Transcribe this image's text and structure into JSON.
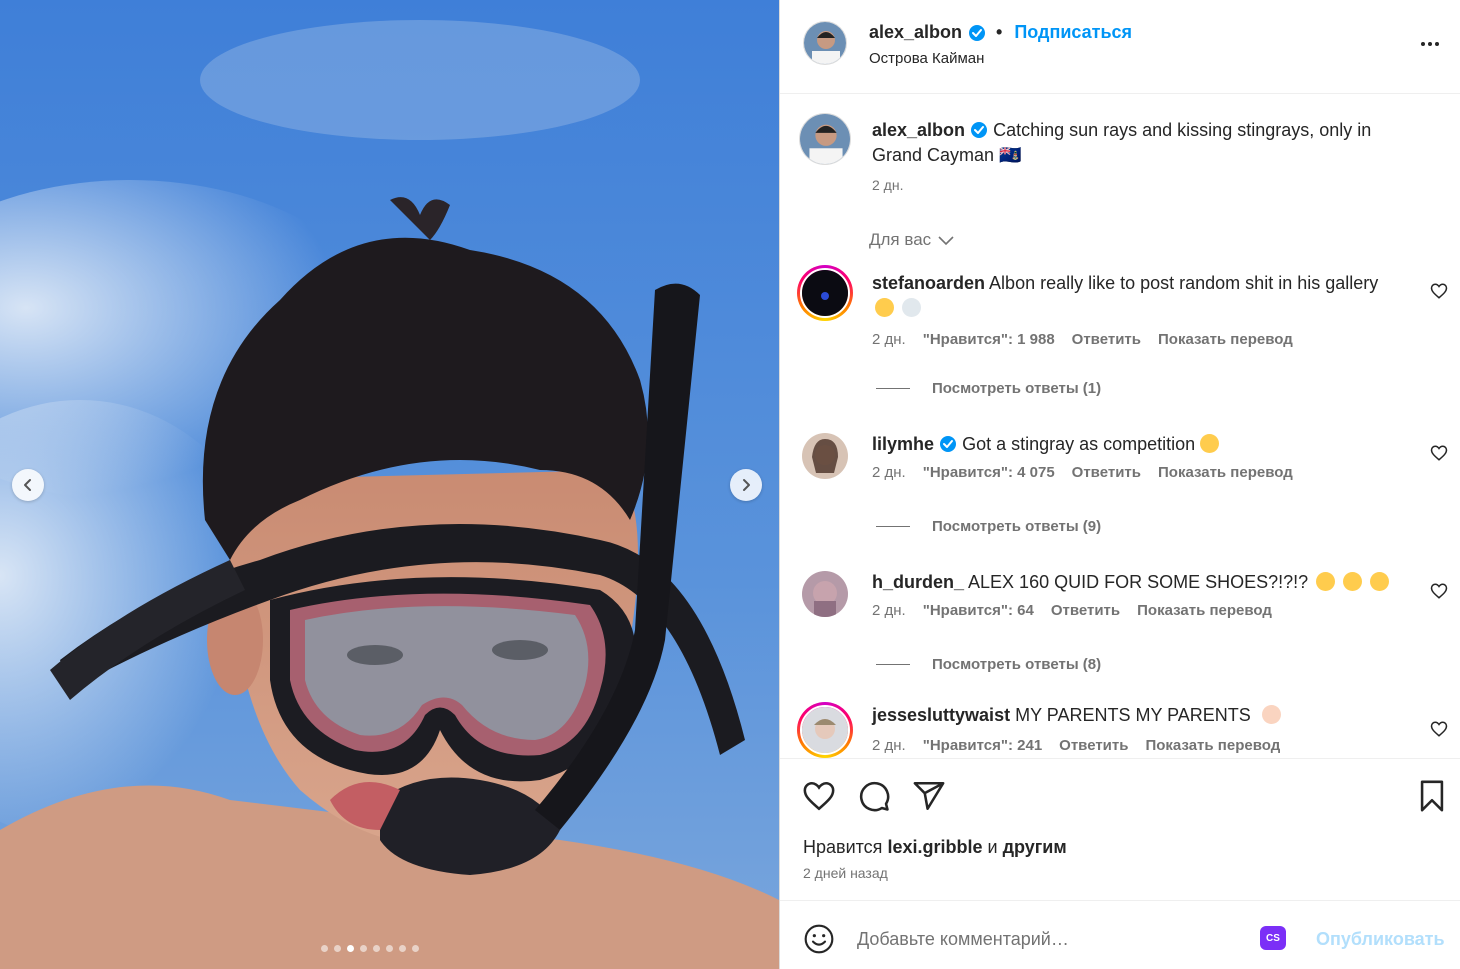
{
  "post": {
    "author": "alex_albon",
    "follow_label": "Подписаться",
    "separator": "•",
    "location": "Острова Кайман",
    "caption": "Catching sun rays and kissing stingrays, only in Grand Cayman 🇰🇾",
    "caption_time": "2 дн.",
    "for_you_label": "Для вас",
    "carousel": {
      "total_dots": 8,
      "active_dot": 3
    }
  },
  "comments": [
    {
      "username": "stefanoarden",
      "verified": false,
      "text": "Albon really like to post random shit in his gallery",
      "time": "2 дн.",
      "likes": "\"Нравится\": 1 988",
      "reply": "Ответить",
      "translate": "Показать перевод",
      "replies": "Посмотреть ответы (1)"
    },
    {
      "username": "lilymhe",
      "verified": true,
      "text": "Got a stingray as competition",
      "time": "2 дн.",
      "likes": "\"Нравится\": 4 075",
      "reply": "Ответить",
      "translate": "Показать перевод",
      "replies": "Посмотреть ответы (9)"
    },
    {
      "username": "h_durden_",
      "verified": false,
      "text": "ALEX 160 QUID FOR SOME SHOES?!?!?",
      "time": "2 дн.",
      "likes": "\"Нравится\": 64",
      "reply": "Ответить",
      "translate": "Показать перевод",
      "replies": "Посмотреть ответы (8)"
    },
    {
      "username": "jessesluttywaist",
      "verified": false,
      "text": "MY PARENTS MY PARENTS",
      "time": "2 дн.",
      "likes": "\"Нравится\": 241",
      "reply": "Ответить",
      "translate": "Показать перевод"
    }
  ],
  "likes_line": {
    "prefix": "Нравится",
    "user": "lexi.gribble",
    "conj": "и",
    "others": "другим"
  },
  "posted_ago": "2 дней назад",
  "composer": {
    "placeholder": "Добавьте комментарий…",
    "cs_badge": "CS",
    "publish_label": "Опубликовать"
  },
  "icons": {
    "verified": "verified-badge-icon",
    "heart": "heart-icon",
    "comment": "comment-icon",
    "share": "share-icon",
    "save": "bookmark-icon",
    "emoji": "emoji-icon",
    "more": "more-icon"
  },
  "colors": {
    "accent": "#0095f6",
    "publish_disabled": "#b2dffc",
    "secondary_text": "#737373",
    "sky": "#4c86d6"
  }
}
